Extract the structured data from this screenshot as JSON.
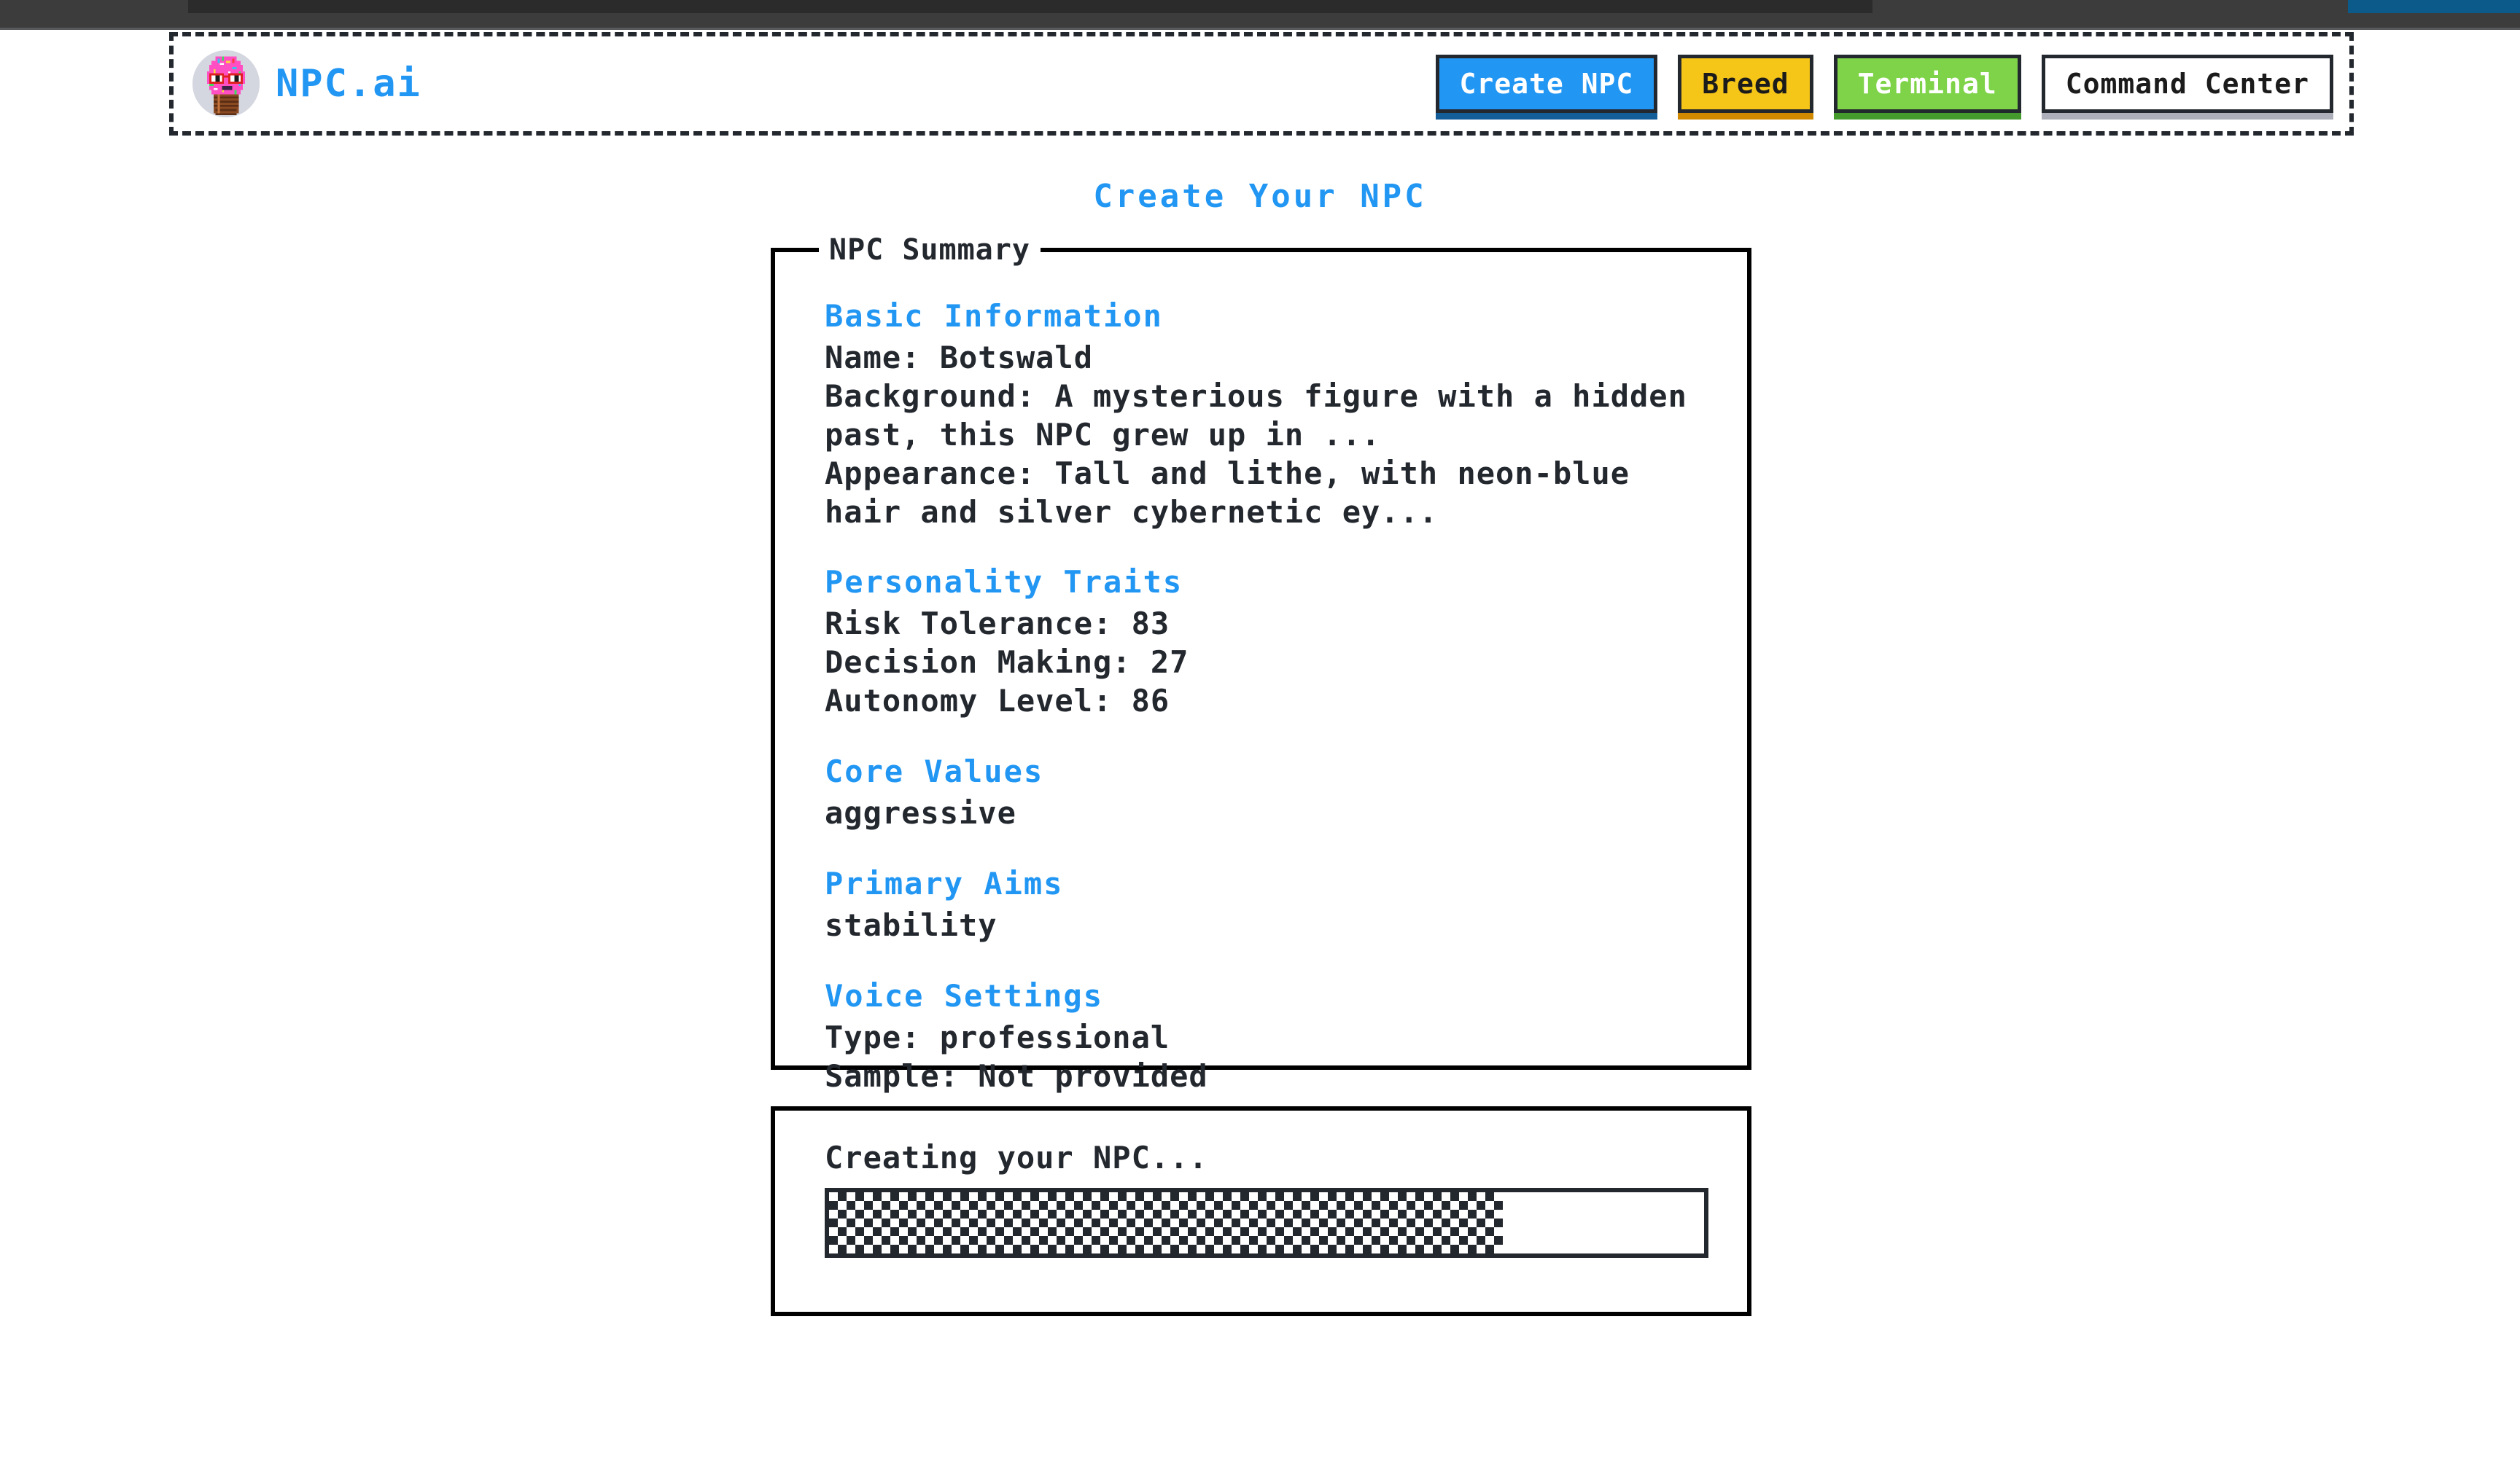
{
  "browser": {
    "tab_strip": "browser-tab-strip",
    "active_tab": "active-tab",
    "secondary_tab": "secondary-tab"
  },
  "header": {
    "logo_icon": "ice-cream-cone-logo-icon",
    "brand": "NPC.ai",
    "nav": [
      {
        "label": "Create NPC",
        "style": "primary"
      },
      {
        "label": "Breed",
        "style": "warn"
      },
      {
        "label": "Terminal",
        "style": "success"
      },
      {
        "label": "Command Center",
        "style": "neutral"
      }
    ]
  },
  "page": {
    "title": "Create Your NPC"
  },
  "summary": {
    "legend": "NPC Summary",
    "sections": [
      {
        "title": "Basic Information",
        "lines": [
          "Name: Botswald",
          "Background: A mysterious figure with a hidden past, this NPC grew up in ...",
          "Appearance: Tall and lithe, with neon-blue hair and silver cybernetic ey..."
        ]
      },
      {
        "title": "Personality Traits",
        "lines": [
          "Risk Tolerance: 83",
          "Decision Making: 27",
          "Autonomy Level: 86"
        ]
      },
      {
        "title": "Core Values",
        "lines": [
          "aggressive"
        ]
      },
      {
        "title": "Primary Aims",
        "lines": [
          "stability"
        ]
      },
      {
        "title": "Voice Settings",
        "lines": [
          "Type: professional",
          "Sample: Not provided"
        ]
      }
    ]
  },
  "progress": {
    "label": "Creating your NPC...",
    "percent": 77
  },
  "colors": {
    "accent_blue": "#2196f3",
    "button_yellow": "#f5c518",
    "button_green": "#7ed348",
    "ink": "#23272e",
    "logo_frosting": "#ff4fc3"
  }
}
